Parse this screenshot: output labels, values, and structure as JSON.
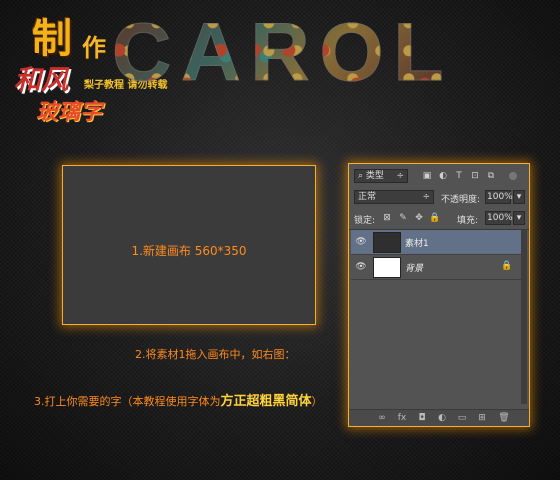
{
  "header": {
    "logo": {
      "zhi": "制",
      "zuo": "作",
      "hefeng": "和风",
      "tagline": "梨子教程 请勿转载",
      "boli": "玻璃字"
    },
    "big_title": "CAROL"
  },
  "canvas": {
    "label": "1.新建画布 560*350"
  },
  "layers_panel": {
    "filter": {
      "search_icon": "⌕",
      "value": "类型",
      "arrow": "÷"
    },
    "filter_icons": [
      "▣",
      "◐",
      "T",
      "⊡",
      "⧉"
    ],
    "blend_mode": {
      "value": "正常",
      "arrow": "÷"
    },
    "opacity": {
      "label": "不透明度:",
      "value": "100%"
    },
    "lock": {
      "label": "锁定:",
      "icons": [
        "⊠",
        "✎",
        "✥",
        "🔒"
      ]
    },
    "fill": {
      "label": "填充:",
      "value": "100%"
    },
    "layers": [
      {
        "name": "素材1",
        "visible_icon": "👁",
        "selected": true
      },
      {
        "name": "背景",
        "visible_icon": "👁",
        "selected": false,
        "locked_icon": "🔒"
      }
    ],
    "footer_icons": [
      "∞",
      "fx",
      "◘",
      "◐",
      "▭",
      "⊞",
      "🗑"
    ]
  },
  "steps": {
    "step2": "2.将素材1拖入画布中，如右图：",
    "step3_prefix": "3.打上你需要的字（本教程使用字体为",
    "step3_font": "方正超粗黑简体",
    "step3_suffix": "）"
  },
  "colors": {
    "accent_orange": "#ff8a1e",
    "highlight_yellow": "#ffd23a",
    "panel_bg": "#535353",
    "selected_layer": "#627187",
    "glow_border": "#f6b030"
  }
}
